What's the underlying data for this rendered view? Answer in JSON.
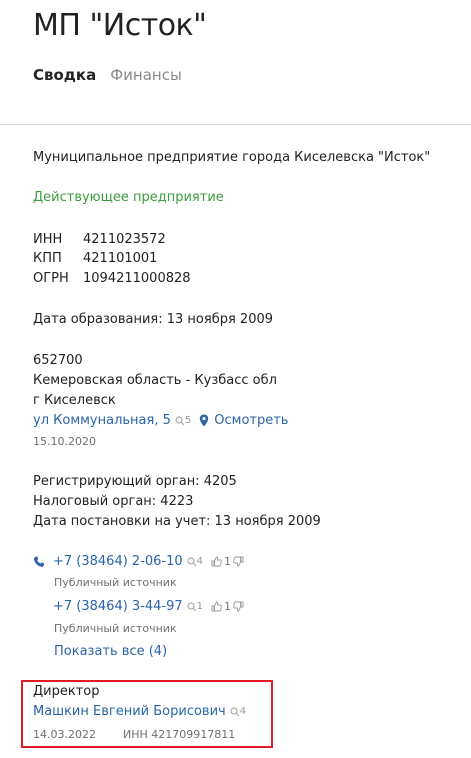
{
  "header": {
    "title": "МП \"Исток\"",
    "tabs": [
      {
        "label": "Сводка",
        "active": true
      },
      {
        "label": "Финансы",
        "active": false
      }
    ]
  },
  "company": {
    "full_name": "Муниципальное предприятие города Киселевска \"Исток\"",
    "status": "Действующее предприятие",
    "ids": [
      {
        "label": "ИНН",
        "value": "4211023572"
      },
      {
        "label": "КПП",
        "value": "421101001"
      },
      {
        "label": "ОГРН",
        "value": "1094211000828"
      }
    ],
    "founded": "Дата образования: 13 ноября 2009"
  },
  "address": {
    "postcode": "652700",
    "region": "Кемеровская область - Кузбасс обл",
    "city": "г Киселевск",
    "street": "ул Коммунальная, 5",
    "street_count": "5",
    "map_link": "Осмотреть",
    "date": "15.10.2020"
  },
  "registration": {
    "reg_authority": "Регистрирующий орган: 4205",
    "tax_authority": "Налоговый орган: 4223",
    "reg_date": "Дата постановки на учет: 13 ноября 2009"
  },
  "phones": [
    {
      "number": "+7 (38464) 2-06-10",
      "count": "4",
      "likes": "1",
      "source": "Публичный источник"
    },
    {
      "number": "+7 (38464) 3-44-97",
      "count": "1",
      "likes": "1",
      "source": "Публичный источник"
    }
  ],
  "show_all": "Показать все (4)",
  "director": {
    "role": "Директор",
    "name": "Машкин Евгений Борисович",
    "count": "4",
    "date": "14.03.2022",
    "inn": "ИНН 421709917811"
  },
  "colors": {
    "link": "#2a64a8",
    "status_green": "#3d9a3d",
    "highlight_red": "#e01b24"
  },
  "icons": [
    "search-icon",
    "map-pin-icon",
    "phone-icon",
    "thumbs-up-icon",
    "thumbs-down-icon"
  ]
}
